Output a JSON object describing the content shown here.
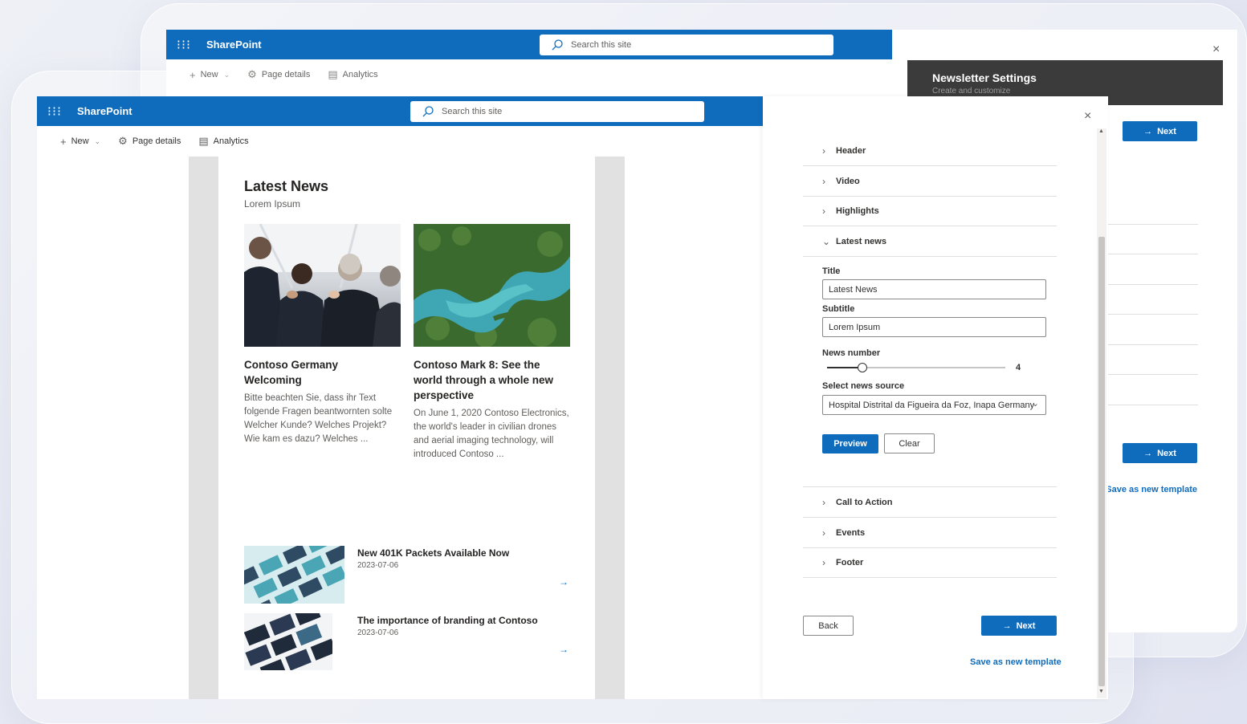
{
  "back_window": {
    "brand": "SharePoint",
    "search_placeholder": "Search this site",
    "cmd_new": "New",
    "cmd_page_details": "Page details",
    "cmd_analytics": "Analytics",
    "newsletter_title": "Newsletter Settings",
    "newsletter_subtitle": "Create and customize",
    "next_label": "Next",
    "save_template_label": "Save as new template"
  },
  "front_window": {
    "brand": "SharePoint",
    "search_placeholder": "Search this site",
    "cmd_new": "New",
    "cmd_page_details": "Page details",
    "cmd_analytics": "Analytics"
  },
  "news": {
    "title": "Latest News",
    "subtitle": "Lorem Ipsum",
    "cards": [
      {
        "title": "Contoso Germany Welcoming",
        "text": "Bitte beachten Sie, dass ihr Text folgende Fragen beantwornten solte Welcher Kunde? Welches Projekt? Wie kam es dazu? Welches ..."
      },
      {
        "title": "Contoso Mark 8: See the world through a whole new perspective",
        "text": "On June 1, 2020 Contoso Electronics, the world's leader in civilian drones and aerial imaging technology, will introduced Contoso ..."
      }
    ],
    "list": [
      {
        "title": "New 401K Packets Available Now",
        "date": "2023-07-06",
        "arrow": "→"
      },
      {
        "title": "The importance of branding at Contoso",
        "date": "2023-07-06",
        "arrow": "→"
      }
    ]
  },
  "panel": {
    "close_glyph": "×",
    "sections_top": [
      {
        "label": "Header"
      },
      {
        "label": "Video"
      },
      {
        "label": "Highlights"
      }
    ],
    "expanded_section": {
      "label": "Latest news"
    },
    "fields": {
      "title_label": "Title",
      "title_value": "Latest News",
      "subtitle_label": "Subtitle",
      "subtitle_value": "Lorem Ipsum",
      "news_number_label": "News number",
      "news_number_value": "4",
      "news_number_fraction": 0.2,
      "source_label": "Select news source",
      "source_value": "Hospital Distrital da Figueira da Foz, Inapa Germany"
    },
    "preview_label": "Preview",
    "clear_label": "Clear",
    "sections_bottom": [
      {
        "label": "Call to Action"
      },
      {
        "label": "Events"
      },
      {
        "label": "Footer"
      }
    ],
    "back_label": "Back",
    "next_label": "Next",
    "save_template_label": "Save as new template"
  },
  "colors": {
    "brand_blue": "#0f6cbd",
    "dark_header": "#3b3b3b"
  }
}
